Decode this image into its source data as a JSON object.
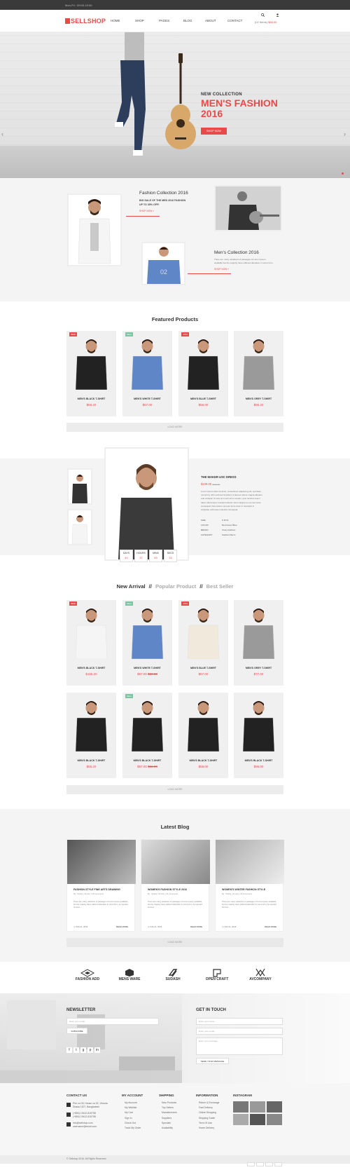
{
  "topbar": {
    "hours": "Mon-Fri : 09:00-19:00"
  },
  "header": {
    "logo": "SELLSHOP",
    "nav": [
      "HOME",
      "SHOP",
      "PAGES",
      "BLOG",
      "ABOUT",
      "CONTACT"
    ],
    "cart_count": "(02 Items)",
    "cart_total": "$86.00"
  },
  "hero": {
    "eyebrow": "NEW COLLECTION",
    "title1": "MEN'S FASHION",
    "title2": "2016",
    "button": "SHOP NOW"
  },
  "collection": {
    "c1_title": "Fashion Collection 2016",
    "c1_desc1": "BIG SALE OF THE MEN 2016 FASHION",
    "c1_desc2": "UP TO 35% OFF!",
    "c1_link": "SHOP NOW »",
    "c2_title": "Men's Collection 2016",
    "c2_desc1": "There are many variations of passages of Lorem Ipsum",
    "c2_desc2": "available but the majority have suffered alteration in some form.",
    "c2_link": "SHOP NOW »"
  },
  "featured": {
    "title": "Featured Products",
    "load_more": "LOAD MORE",
    "items": [
      {
        "tag": "NEW",
        "name": "MEN'S BLACK T-SHIRT",
        "price": "$65.20",
        "color": "#e84a4a"
      },
      {
        "tag": "SELL",
        "name": "MEN'S WHITE T-SHIRT",
        "price": "$57.00",
        "color": "#7cc5a2"
      },
      {
        "tag": "-15%",
        "name": "MEN'S BLUE T-SHIRT",
        "price": "$56.00",
        "color": "#e84a4a"
      },
      {
        "tag": "",
        "name": "MEN'S GREY T-SHIRT",
        "price": "$96.20",
        "color": ""
      }
    ]
  },
  "deal": {
    "title": "THE MAKER USC DRESS",
    "price": "$109.00",
    "old_price": "$120.00",
    "desc1": "Lorem ipsum dolor sit amet, consectetur adipiscing elit, sed diam",
    "desc2": "nonummy nibh euismod tincidunt ut laoreet dolore magna aliquam",
    "desc3": "erat volutpat. Ut wisi enim ad minim veniam, quis nostrud exerci",
    "desc4": "tation ullamcorper suscipit lobortis nisl ut aliquip ex ea commodo",
    "desc5": "consequat. Duis autem vel eum iriure dolor in hendrerit in",
    "desc6": "vulputate velit esse molestie consequat.",
    "size_label": "SIZE",
    "sizes": "S    M    XL",
    "color_label": "COLOR",
    "colors": "Red   Green   Blue",
    "brand_label": "BRAND",
    "brand": "Crazy Fashion",
    "cat_label": "CATEGORY",
    "category": "Fashion Men's",
    "countdown": [
      {
        "l": "DAYS",
        "v": "40"
      },
      {
        "l": "HOURS",
        "v": "37"
      },
      {
        "l": "MINS",
        "v": "59"
      },
      {
        "l": "SECS",
        "v": "33"
      }
    ]
  },
  "arrivals": {
    "tab1": "New Arrival",
    "sep": "//",
    "tab2": "Popular Product",
    "tab3": "Best Seller",
    "load_more": "LOAD MORE",
    "items": [
      {
        "tag": "NEW",
        "name": "MEN'S BLACK T-SHIRT",
        "price": "$165.20",
        "old": "",
        "color": "#e84a4a"
      },
      {
        "tag": "SELL",
        "name": "MEN'S WHITE T-SHIRT",
        "price": "$57.00",
        "old": "$60.00",
        "color": "#7cc5a2"
      },
      {
        "tag": "-15%",
        "name": "MEN'S BLUE T-SHIRT",
        "price": "$67.00",
        "old": "",
        "color": "#e84a4a"
      },
      {
        "tag": "",
        "name": "MEN'S GREY T-SHIRT",
        "price": "$77.00",
        "old": "",
        "color": ""
      },
      {
        "tag": "",
        "name": "MEN'S BLACK T-SHIRT",
        "price": "$65.20",
        "old": "",
        "color": ""
      },
      {
        "tag": "SELL",
        "name": "MEN'S BLACK T-SHIRT",
        "price": "$57.00",
        "old": "$62.00",
        "color": "#7cc5a2"
      },
      {
        "tag": "",
        "name": "MEN'S BLACK T-SHIRT",
        "price": "$56.00",
        "old": "",
        "color": ""
      },
      {
        "tag": "",
        "name": "MEN'S BLACK T-SHIRT",
        "price": "$96.00",
        "old": "",
        "color": ""
      }
    ]
  },
  "blog": {
    "title": "Latest Blog",
    "load_more": "LOAD MORE",
    "posts": [
      {
        "title": "FASHION STYLE FINE ARTS DRAWING",
        "meta": "By : Shaha | 32 Like | 16 Comments",
        "desc": "There are many variations of passages of Lorem Ipsum available, but the majority have suffered alteration in some form, by injected humour...",
        "date": "JUN 21, 2016",
        "more": "READ MORE"
      },
      {
        "title": "WOMEN'S FASHION STYLE 2016",
        "meta": "By : Shaha | 32 Like | 16 Comments",
        "desc": "There are many variations of passages of Lorem Ipsum available, but the majority have suffered alteration in some form, by injected humour...",
        "date": "JUN 21, 2016",
        "more": "READ MORE"
      },
      {
        "title": "WOMEN'S WINTER FASHION STYLE",
        "meta": "By : Shaha | 32 Like | 16 Comments",
        "desc": "There are many variations of passages of Lorem Ipsum available, but the majority have suffered alteration in some form, by injected humour...",
        "date": "JUN 21, 2016",
        "more": "READ MORE"
      }
    ]
  },
  "brands": [
    "FASHION ADD",
    "MENS WARE",
    "SUDASH",
    "OPEN CRAFT",
    "AVCOMPANY"
  ],
  "newsletter": {
    "title": "NEWSLETTER",
    "placeholder": "Enter your email...",
    "button": "SUBSCRIBE"
  },
  "contact": {
    "title": "GET IN TOUCH",
    "name_ph": "Enter your name...",
    "email_ph": "Enter your email...",
    "msg_ph": "Enter your message...",
    "button": "SEND YOUR MESSAGE"
  },
  "footer": {
    "contact_title": "CONTACT US",
    "addr1": "Pier no 05, House no 02, Victoria",
    "addr2": "Dhaka 1207, Bangladesh",
    "phone1": "(+880) 19412-815758",
    "phone2": "(+880) 19412-815758",
    "email1": "info@sellshop.com",
    "email2": "username@email.com",
    "account_title": "MY ACCOUNT",
    "account": [
      "My Account",
      "My Wishlist",
      "My Cart",
      "Sign In",
      "Check Out",
      "Track My Order"
    ],
    "shipping_title": "SHIPPING",
    "shipping": [
      "New Products",
      "Top Sellers",
      "Manufacturers",
      "Suppliers",
      "Specials",
      "Availability"
    ],
    "info_title": "INFORMATION",
    "info": [
      "Return & Exchange",
      "Fast Delivery",
      "Online Shopping",
      "Shipping Guide",
      "Term Of Use",
      "Home Delivery"
    ],
    "insta_title": "INSTAGRAM",
    "copyright": "© Sellshop 2016. All Rights Reserved."
  }
}
